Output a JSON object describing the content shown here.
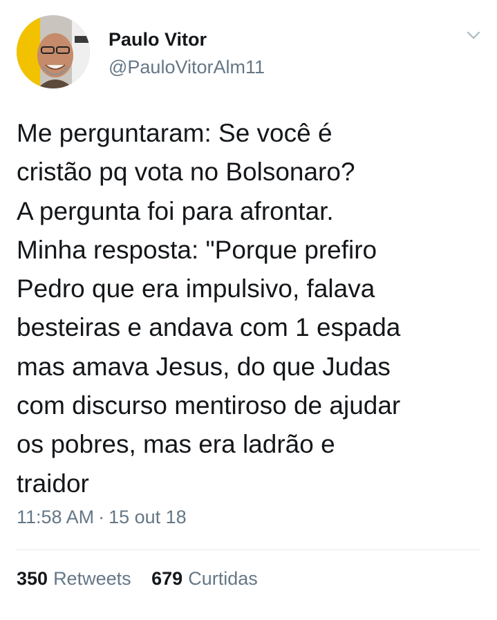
{
  "author": {
    "display_name": "Paulo Vitor",
    "handle": "@PauloVitorAlm11"
  },
  "icons": {
    "menu": "chevron-down-icon",
    "avatar": "profile-photo"
  },
  "tweet": {
    "text": "Me perguntaram: Se você é\ncristão pq vota no Bolsonaro?\nA pergunta foi para afrontar.\nMinha resposta: \"Porque prefiro\nPedro que era impulsivo, falava\nbesteiras e andava com 1 espada\nmas amava Jesus, do que Judas\ncom discurso mentiroso de ajudar\nos pobres, mas era ladrão e\ntraidor",
    "time": "11:58 AM",
    "separator": "·",
    "date": "15 out 18"
  },
  "stats": {
    "retweets_count": "350",
    "retweets_label": "Retweets",
    "likes_count": "679",
    "likes_label": "Curtidas"
  },
  "colors": {
    "text": "#14171a",
    "secondary": "#657786",
    "divider": "#e1e8ed",
    "avatar_background": "#f2c200"
  }
}
